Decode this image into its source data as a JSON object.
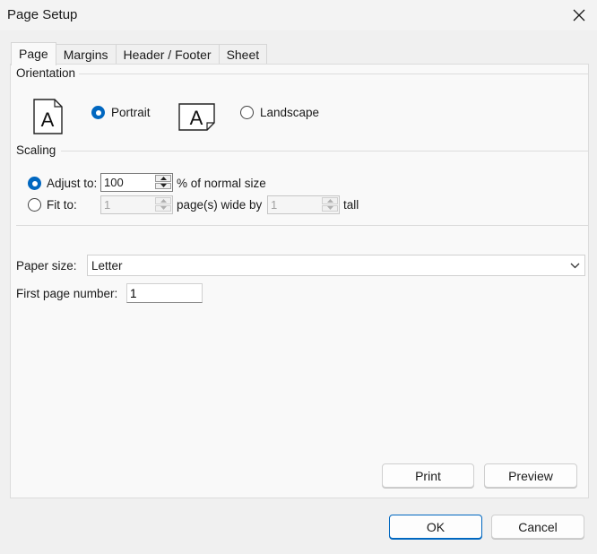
{
  "window": {
    "title": "Page Setup",
    "close_icon": "close-icon"
  },
  "tabs": [
    {
      "label": "Page",
      "active": true
    },
    {
      "label": "Margins",
      "active": false
    },
    {
      "label": "Header / Footer",
      "active": false
    },
    {
      "label": "Sheet",
      "active": false
    }
  ],
  "orientation": {
    "section_label": "Orientation",
    "portrait_label": "Portrait",
    "landscape_label": "Landscape",
    "selected": "portrait",
    "icon_glyph": "A"
  },
  "scaling": {
    "section_label": "Scaling",
    "adjust_label": "Adjust to:",
    "adjust_value": "100",
    "adjust_suffix": "% of normal size",
    "fit_label": "Fit to:",
    "fit_wide_value": "1",
    "fit_wide_suffix": "page(s) wide by",
    "fit_tall_value": "1",
    "fit_tall_suffix": "tall",
    "selected": "adjust"
  },
  "paper": {
    "label": "Paper size:",
    "value": "Letter"
  },
  "first_page": {
    "label": "First page number:",
    "value": "1"
  },
  "panel_buttons": {
    "print": "Print",
    "preview": "Preview"
  },
  "dialog_buttons": {
    "ok": "OK",
    "cancel": "Cancel"
  },
  "colors": {
    "accent": "#0067c0",
    "background": "#f0f0f0",
    "panel": "#f9f9f9"
  }
}
